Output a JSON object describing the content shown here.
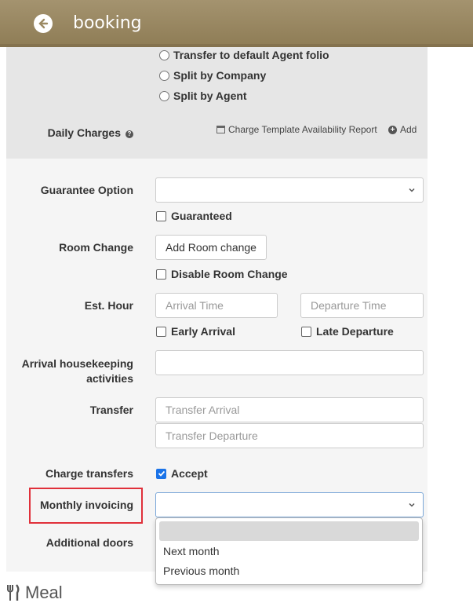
{
  "header": {
    "title": "booking",
    "back_icon": "circle-arrow-left-icon"
  },
  "split_options": [
    {
      "label": "Transfer to default Agent folio"
    },
    {
      "label": "Split by Company"
    },
    {
      "label": "Split by Agent"
    }
  ],
  "daily_charges": {
    "label": "Daily Charges",
    "report_link": "Charge Template Availability Report",
    "add_link": "Add"
  },
  "guarantee": {
    "label": "Guarantee Option",
    "value": "",
    "checkbox_label": "Guaranteed",
    "checked": false
  },
  "room_change": {
    "label": "Room Change",
    "button": "Add Room change",
    "checkbox_label": "Disable Room Change",
    "checked": false
  },
  "est_hour": {
    "label": "Est. Hour",
    "arrival_placeholder": "Arrival Time",
    "departure_placeholder": "Departure Time",
    "early_label": "Early Arrival",
    "late_label": "Late Departure"
  },
  "housekeeping": {
    "label_line1": "Arrival housekeeping",
    "label_line2": "activities",
    "value": ""
  },
  "transfer": {
    "label": "Transfer",
    "arrival_placeholder": "Transfer Arrival",
    "departure_placeholder": "Transfer Departure"
  },
  "charge_transfers": {
    "label": "Charge transfers",
    "checkbox_label": "Accept",
    "checked": true
  },
  "monthly_invoicing": {
    "label": "Monthly invoicing",
    "value": "",
    "options": [
      "",
      "Next month",
      "Previous month"
    ]
  },
  "additional_doors": {
    "label": "Additional doors"
  },
  "meal": {
    "label": "Meal",
    "icon": "utensils-icon"
  },
  "colors": {
    "header": "#9c8a64",
    "highlight": "#e0303a",
    "check": "#1a73e8"
  }
}
